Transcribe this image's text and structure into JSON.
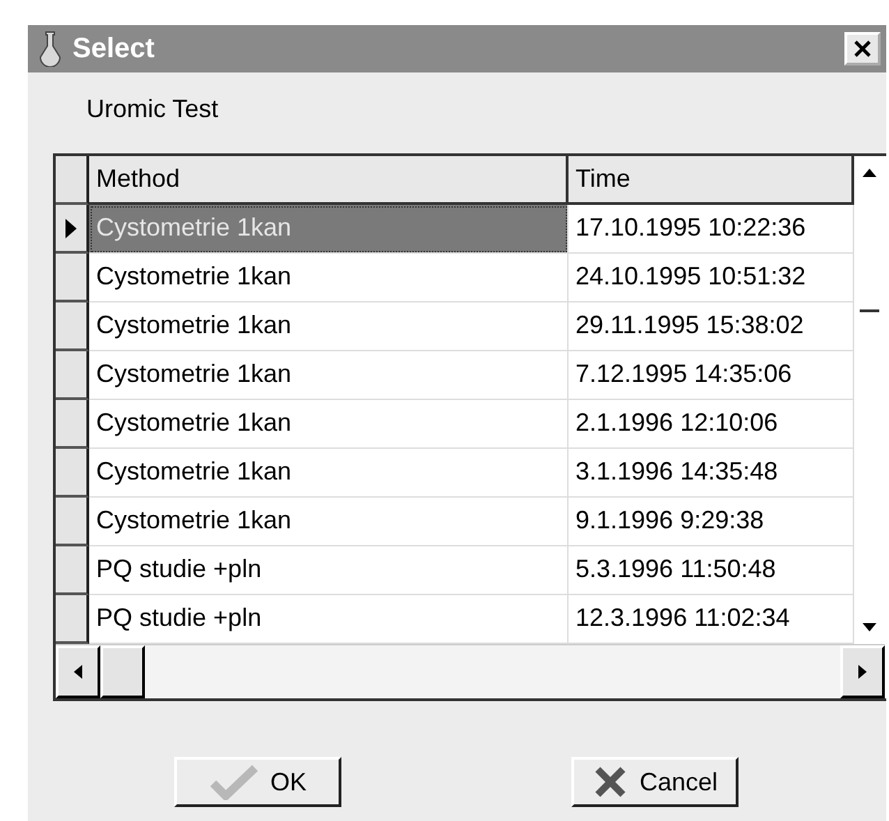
{
  "window": {
    "title": "Select"
  },
  "label": "Uromic Test",
  "table": {
    "columns": [
      "Method",
      "Time"
    ],
    "rows": [
      {
        "method": "Cystometrie 1kan",
        "time": "17.10.1995 10:22:36",
        "selected": true
      },
      {
        "method": "Cystometrie 1kan",
        "time": "24.10.1995 10:51:32",
        "selected": false
      },
      {
        "method": "Cystometrie 1kan",
        "time": "29.11.1995 15:38:02",
        "selected": false
      },
      {
        "method": "Cystometrie 1kan",
        "time": "7.12.1995 14:35:06",
        "selected": false
      },
      {
        "method": "Cystometrie 1kan",
        "time": "2.1.1996 12:10:06",
        "selected": false
      },
      {
        "method": "Cystometrie 1kan",
        "time": "3.1.1996 14:35:48",
        "selected": false
      },
      {
        "method": "Cystometrie 1kan",
        "time": "9.1.1996 9:29:38",
        "selected": false
      },
      {
        "method": "PQ studie +pln",
        "time": "5.3.1996 11:50:48",
        "selected": false
      },
      {
        "method": "PQ studie +pln",
        "time": "12.3.1996 11:02:34",
        "selected": false
      }
    ]
  },
  "buttons": [
    {
      "kind": "ok",
      "label": "OK"
    },
    {
      "kind": "cancel",
      "label": "Cancel"
    }
  ]
}
